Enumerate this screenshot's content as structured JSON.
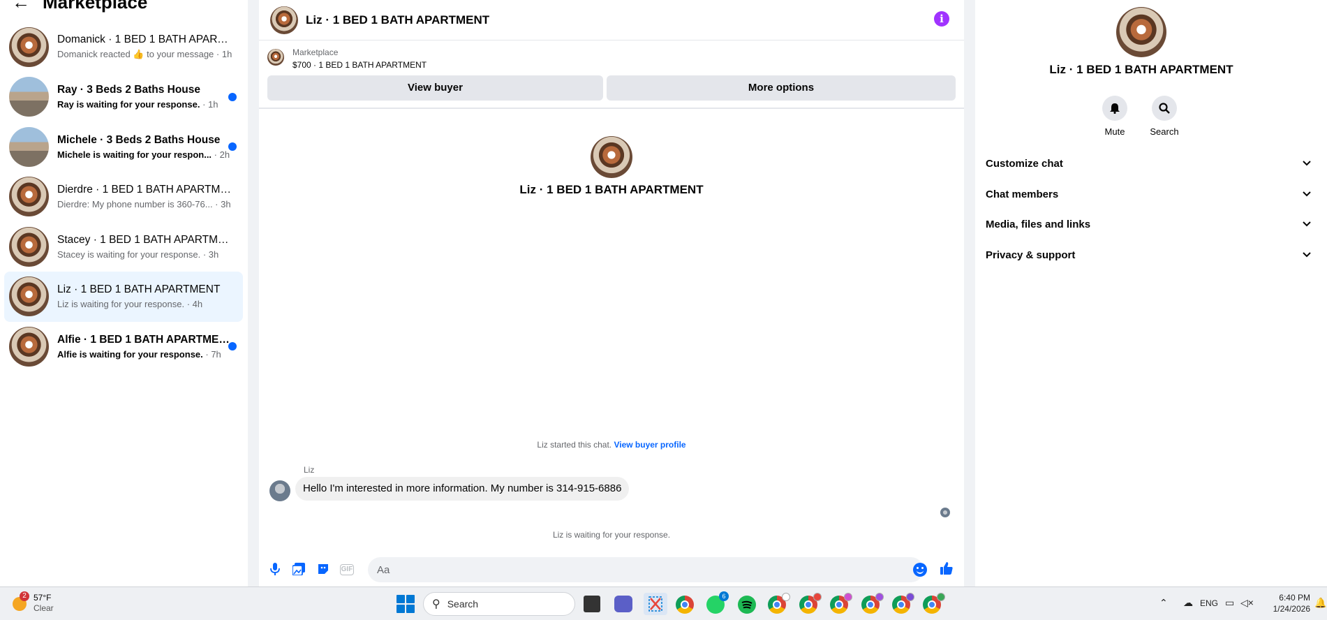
{
  "sidebar": {
    "title": "Marketplace",
    "conversations": [
      {
        "name": "Domanick · 1 BED 1 BATH APARTM...",
        "preview": "Domanick reacted 👍 to your message",
        "time": "1h",
        "unread": false,
        "active": false,
        "thumb": "apartment"
      },
      {
        "name": "Ray · 3 Beds 2 Baths House",
        "preview": "Ray is waiting for your response.",
        "time": "1h",
        "unread": true,
        "active": false,
        "thumb": "house"
      },
      {
        "name": "Michele · 3 Beds 2 Baths House",
        "preview": "Michele is waiting for your respon...",
        "time": "2h",
        "unread": true,
        "active": false,
        "thumb": "house"
      },
      {
        "name": "Dierdre · 1 BED 1 BATH APARTMENT",
        "preview": "Dierdre: My phone number is 360-76...",
        "time": "3h",
        "unread": false,
        "active": false,
        "thumb": "apartment"
      },
      {
        "name": "Stacey · 1 BED 1 BATH APARTMENT",
        "preview": "Stacey is waiting for your response.",
        "time": "3h",
        "unread": false,
        "active": false,
        "thumb": "apartment"
      },
      {
        "name": "Liz · 1 BED 1 BATH APARTMENT",
        "preview": "Liz is waiting for your response.",
        "time": "4h",
        "unread": false,
        "active": true,
        "thumb": "apartment"
      },
      {
        "name": "Alfie · 1 BED 1 BATH APARTMENT",
        "preview": "Alfie is waiting for your response.",
        "time": "7h",
        "unread": true,
        "active": false,
        "thumb": "apartment"
      }
    ]
  },
  "chat": {
    "title": "Liz · 1 BED 1 BATH APARTMENT",
    "listing": {
      "source": "Marketplace",
      "title": "$700 · 1 BED 1 BATH APARTMENT",
      "view_buyer_label": "View buyer",
      "more_options_label": "More options"
    },
    "intro_name": "Liz · 1 BED 1 BATH APARTMENT",
    "started_text": "Liz started this chat.",
    "view_buyer_profile_label": "View buyer profile",
    "sender_name": "Liz",
    "message": "Hello I'm interested in more information. My number is 314-915-6886",
    "waiting_text": "Liz is waiting for your response.",
    "composer": {
      "placeholder": "Aa",
      "gif_label": "GIF"
    }
  },
  "info_panel": {
    "name": "Liz · 1 BED 1 BATH APARTMENT",
    "mute_label": "Mute",
    "search_label": "Search",
    "sections": [
      "Customize chat",
      "Chat members",
      "Media, files and links",
      "Privacy & support"
    ]
  },
  "taskbar": {
    "weather_temp": "57°F",
    "weather_desc": "Clear",
    "weather_badge": "2",
    "search_label": "Search",
    "whatsapp_badge": "6",
    "language": "ENG",
    "time": "6:40 PM",
    "date": "1/24/2026"
  },
  "colors": {
    "accent": "#0866ff",
    "info": "#a033ff",
    "active_row": "#ebf5ff"
  }
}
